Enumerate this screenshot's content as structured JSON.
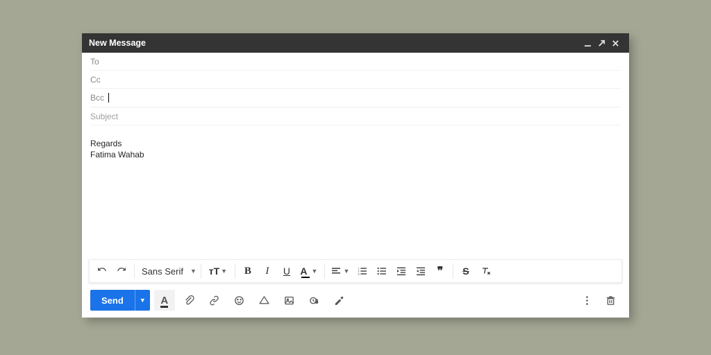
{
  "window": {
    "title": "New Message"
  },
  "fields": {
    "to_label": "To",
    "cc_label": "Cc",
    "bcc_label": "Bcc",
    "subject_placeholder": "Subject"
  },
  "body": {
    "line1": "Regards",
    "line2": "Fatima Wahab"
  },
  "format_toolbar": {
    "font_name": "Sans Serif",
    "size_glyph": "тT",
    "quote_glyph": "❞"
  },
  "actions": {
    "send_label": "Send"
  }
}
